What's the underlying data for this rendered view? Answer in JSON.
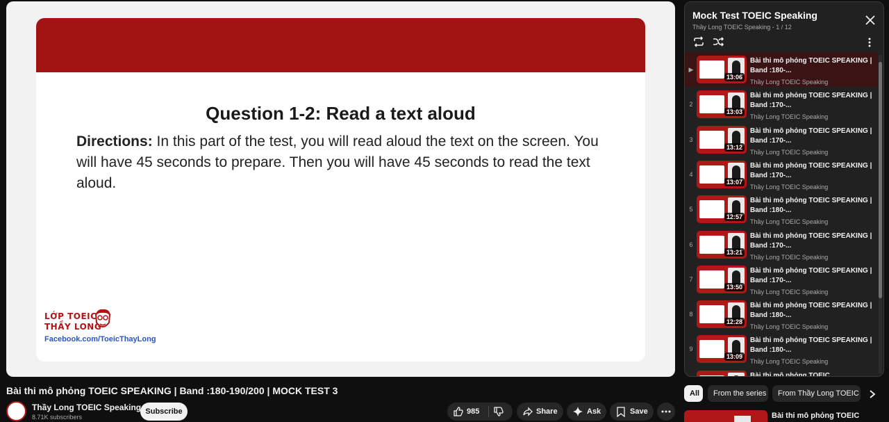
{
  "slide": {
    "question": "Question 1-2: Read a text aloud",
    "directions_label": "Directions:",
    "directions_text": " In this part of the test, you will read aloud the text on the screen. You will have 45 seconds to prepare. Then you will have 45 seconds to read the text aloud.",
    "logo_line1": "LỚP TOEIC",
    "logo_line2": "THẦY LONG",
    "logo_link": "Facebook.com/ToeicThayLong"
  },
  "playlist": {
    "title": "Mock Test TOEIC Speaking",
    "subtitle": "Thầy Long TOEIC Speaking - 1 / 12",
    "items": [
      {
        "index": "▶",
        "title": "Bài thi mô phỏng TOEIC SPEAKING | Band :180-...",
        "channel": "Thầy Long TOEIC Speaking",
        "duration": "13:06",
        "active": true
      },
      {
        "index": "2",
        "title": "Bài thi mô phỏng TOEIC SPEAKING | Band :170-...",
        "channel": "Thầy Long TOEIC Speaking",
        "duration": "13:03"
      },
      {
        "index": "3",
        "title": "Bài thi mô phỏng TOEIC SPEAKING | Band :170-...",
        "channel": "Thầy Long TOEIC Speaking",
        "duration": "13:12"
      },
      {
        "index": "4",
        "title": "Bài thi mô phỏng TOEIC SPEAKING | Band :170-...",
        "channel": "Thầy Long TOEIC Speaking",
        "duration": "13:07"
      },
      {
        "index": "5",
        "title": "Bài thi mô phỏng TOEIC SPEAKING | Band :180-...",
        "channel": "Thầy Long TOEIC Speaking",
        "duration": "12:57"
      },
      {
        "index": "6",
        "title": "Bài thi mô phỏng TOEIC SPEAKING | Band :170-...",
        "channel": "Thầy Long TOEIC Speaking",
        "duration": "13:21"
      },
      {
        "index": "7",
        "title": "Bài thi mô phỏng TOEIC SPEAKING | Band :170-...",
        "channel": "Thầy Long TOEIC Speaking",
        "duration": "13:50"
      },
      {
        "index": "8",
        "title": "Bài thi mô phỏng TOEIC SPEAKING | Band :180-...",
        "channel": "Thầy Long TOEIC Speaking",
        "duration": "12:28"
      },
      {
        "index": "9",
        "title": "Bài thi mô phỏng TOEIC SPEAKING | Band :180-...",
        "channel": "Thầy Long TOEIC Speaking",
        "duration": "13:09"
      },
      {
        "index": "10",
        "title": "Bài thi mô phỏng TOEIC",
        "channel": "",
        "duration": ""
      }
    ]
  },
  "video": {
    "title": "Bài thi mô phỏng TOEIC SPEAKING | Band :180-190/200 | MOCK TEST 3",
    "channel": "Thầy Long TOEIC Speaking",
    "subscribers": "8.71K subscribers",
    "subscribe_label": "Subscribe",
    "likes": "985",
    "share_label": "Share",
    "ask_label": "Ask",
    "save_label": "Save"
  },
  "chips": [
    "All",
    "From the series",
    "From Thầy Long TOEIC Sp"
  ],
  "recommended": {
    "title": "Bài thi mô phỏng TOEIC"
  },
  "colors": {
    "brand_red": "#a01414",
    "background": "#0f0f0f",
    "panel": "#212121"
  }
}
